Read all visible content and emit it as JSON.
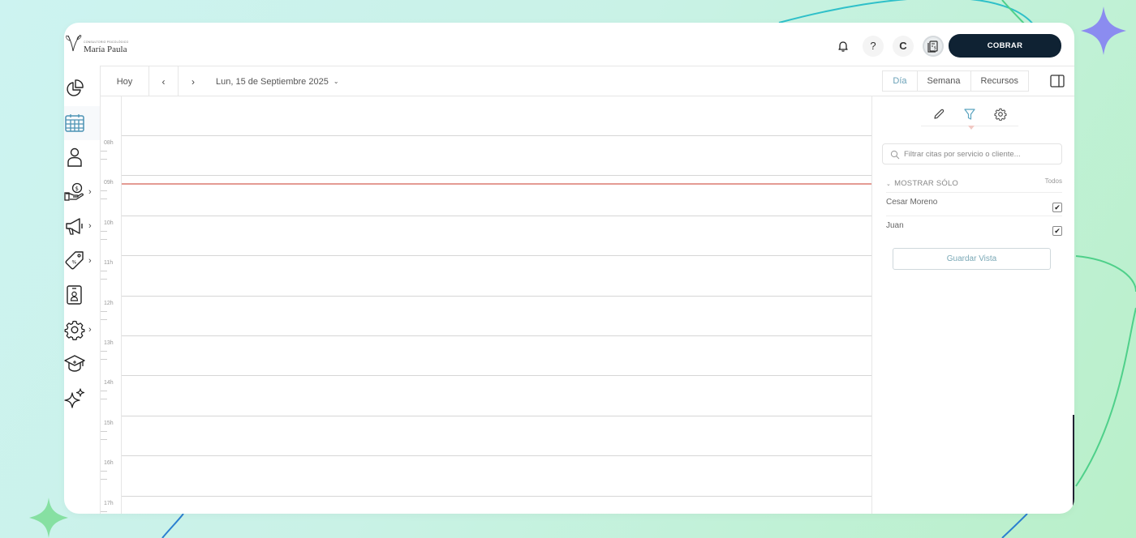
{
  "brand": {
    "tagline": "Consultorio Psicológico",
    "name": "María Paula"
  },
  "topbar": {
    "help_label": "?",
    "user_initial": "C",
    "cobrar_label": "COBRAR"
  },
  "sidebar": {
    "items": [
      {
        "icon": "chart-pie-icon",
        "has_submenu": false
      },
      {
        "icon": "calendar-icon",
        "has_submenu": false,
        "active": true
      },
      {
        "icon": "user-icon",
        "has_submenu": false
      },
      {
        "icon": "hand-money-icon",
        "has_submenu": true
      },
      {
        "icon": "megaphone-icon",
        "has_submenu": true
      },
      {
        "icon": "tag-icon",
        "has_submenu": true
      },
      {
        "icon": "id-badge-icon",
        "has_submenu": false
      },
      {
        "icon": "gear-icon",
        "has_submenu": true
      },
      {
        "icon": "graduation-cap-icon",
        "has_submenu": false
      },
      {
        "icon": "sparkles-icon",
        "has_submenu": false
      }
    ],
    "chevron": "›"
  },
  "calendar": {
    "today_label": "Hoy",
    "prev_label": "‹",
    "next_label": "›",
    "date_label": "Lun, 15 de Septiembre 2025",
    "date_dropdown": "⌄",
    "views": [
      "Día",
      "Semana",
      "Recursos"
    ],
    "active_view": "Día",
    "hours": [
      "08h",
      "09h",
      "10h",
      "11h",
      "12h",
      "13h",
      "14h",
      "15h",
      "16h",
      "17h"
    ],
    "current_time_hour": "09h"
  },
  "panel": {
    "tabs": [
      "pencil-icon",
      "filter-icon",
      "gear-icon"
    ],
    "active_tab": "filter-icon",
    "filter_placeholder": "Filtrar citas por servicio o cliente...",
    "show_only_label": "MOSTRAR SÓLO",
    "show_only_caret": "⌄",
    "all_label": "Todos",
    "people": [
      {
        "name": "Cesar Moreno",
        "checked": true
      },
      {
        "name": "Juan",
        "checked": true
      }
    ],
    "check_glyph": "✔",
    "save_view_label": "Guardar Vista"
  },
  "colors": {
    "cobrar_bg": "#0f2233",
    "accent": "#6aa1b8",
    "now_line": "#e49b93",
    "star_purple": "#8b8cf0",
    "star_green": "#7cdc9c"
  }
}
